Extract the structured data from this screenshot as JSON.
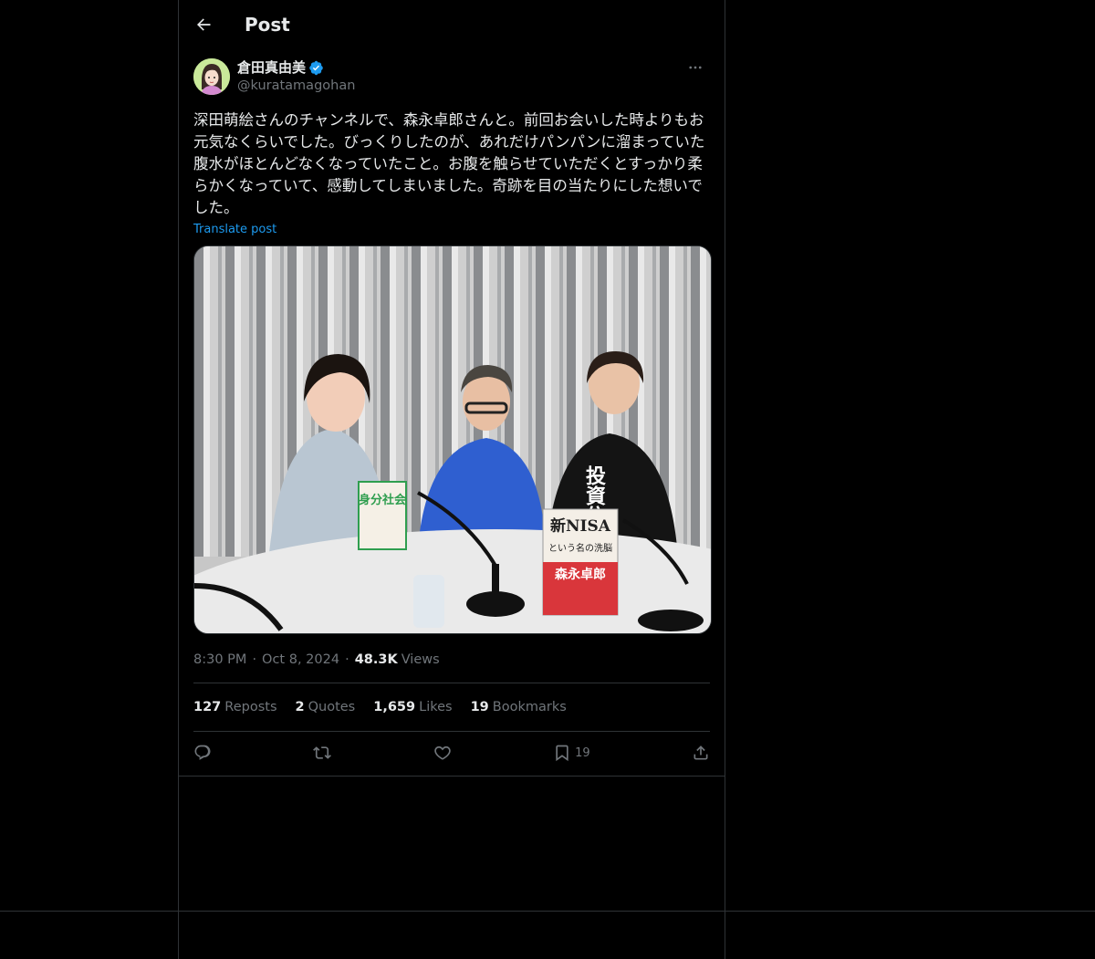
{
  "header": {
    "title": "Post"
  },
  "author": {
    "display_name": "倉田真由美",
    "handle": "@kuratamagohan",
    "verified": true
  },
  "post": {
    "text": "深田萌絵さんのチャンネルで、森永卓郎さんと。前回お会いした時よりもお元気なくらいでした。びっくりしたのが、あれだけパンパンに溜まっていた腹水がほとんどなくなっていたこと。お腹を触らせていただくとすっかり柔らかくなっていて、感動してしまいました。奇跡を目の当たりにした想いでした。",
    "translate_label": "Translate post",
    "time": "8:30 PM",
    "date": "Oct 8, 2024",
    "views_count": "48.3K",
    "views_label": "Views"
  },
  "media": {
    "book1_title": "身分社会",
    "book2_line1": "新NISA",
    "book2_line2": "という名の洗脳",
    "book2_author": "森永卓郎",
    "shirt_text": "投資依"
  },
  "stats": {
    "reposts_count": "127",
    "reposts_label": "Reposts",
    "quotes_count": "2",
    "quotes_label": "Quotes",
    "likes_count": "1,659",
    "likes_label": "Likes",
    "bookmarks_count": "19",
    "bookmarks_label": "Bookmarks"
  },
  "actions": {
    "bookmark_count": "19"
  },
  "icons": [
    "back-arrow-icon",
    "verified-badge-icon",
    "more-icon",
    "reply-icon",
    "repost-icon",
    "like-icon",
    "bookmark-icon",
    "share-icon"
  ],
  "colors": {
    "background": "#000000",
    "accent": "#1d9bf0",
    "muted": "#71767b",
    "border": "#2f3336"
  }
}
